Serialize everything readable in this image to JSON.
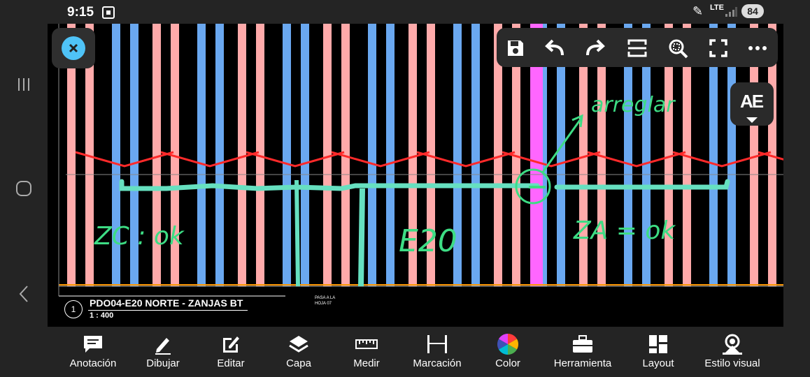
{
  "status_bar": {
    "time": "9:15",
    "network": "LTE",
    "battery": "84"
  },
  "drawing": {
    "title_number": "1",
    "title": "PDO04-E20 NORTE - ZANJAS BT",
    "scale": "1 : 400",
    "note_pasa": "PASA A LA",
    "note_hoja": "HOJA 07",
    "handwritten": {
      "arreglar": "arreglar",
      "zc_ok": "ZC : ok",
      "e20": "E20",
      "za_ok": "ZA = ok"
    }
  },
  "top_toolbar": {
    "buttons": [
      "save",
      "undo",
      "redo",
      "fit",
      "zoom",
      "fullscreen",
      "more"
    ]
  },
  "text_style_button": {
    "label": "AE"
  },
  "bottom_toolbar": {
    "items": [
      {
        "label": "Anotación",
        "icon": "annotation-icon"
      },
      {
        "label": "Dibujar",
        "icon": "pencil-icon"
      },
      {
        "label": "Editar",
        "icon": "edit-icon"
      },
      {
        "label": "Capa",
        "icon": "layers-icon"
      },
      {
        "label": "Medir",
        "icon": "ruler-icon"
      },
      {
        "label": "Marcación",
        "icon": "dimension-icon"
      },
      {
        "label": "Color",
        "icon": "color-wheel-icon"
      },
      {
        "label": "Herramienta",
        "icon": "toolbox-icon"
      },
      {
        "label": "Layout",
        "icon": "layout-icon"
      },
      {
        "label": "Estilo visual",
        "icon": "visual-style-icon"
      }
    ]
  },
  "colors": {
    "accent": "#4fc3f7",
    "pink_strip": "#ffaaaa",
    "blue_strip": "#6aa8f0",
    "highlight": "#66e0c0",
    "magenta": "#ff66ff"
  }
}
